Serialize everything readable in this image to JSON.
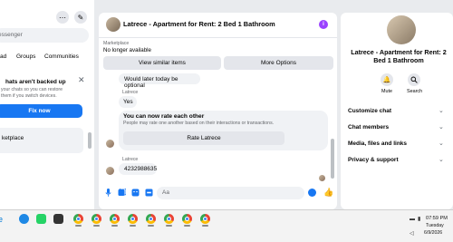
{
  "left_panel": {
    "search_placeholder": "essenger",
    "filters": [
      "ad",
      "Groups",
      "Communities"
    ],
    "backup": {
      "title": "hats aren't backed up",
      "description": "your chats so you can restore them if you switch devices.",
      "button": "Fix now"
    },
    "marketplace_item": "ketplace"
  },
  "chat": {
    "title": "Latrece - Apartment for Rent: 2 Bed 1 Bathroom",
    "info_icon": "i",
    "marketplace_label": "Marketplace",
    "listing_status": "No longer available",
    "view_similar": "View similar items",
    "more_options": "More Options",
    "messages": [
      {
        "text": "Would later today be optional"
      },
      {
        "sender": "Latrece",
        "text": "Yes"
      },
      {
        "sender": "Latrece",
        "text": "4232988635"
      }
    ],
    "rate_card": {
      "title": "You can now rate each other",
      "description": "People may rate one another based on their interactions or transactions.",
      "button": "Rate Latrece"
    },
    "input_placeholder": "Aa",
    "like_icon": "👍"
  },
  "right_panel": {
    "title": "Latrece - Apartment for Rent: 2 Bed 1 Bathroom",
    "actions": [
      {
        "label": "Mute",
        "icon": "bell-icon"
      },
      {
        "label": "Search",
        "icon": "search-icon"
      }
    ],
    "sections": [
      "Customize chat",
      "Chat members",
      "Media, files and links",
      "Privacy & support"
    ]
  },
  "taskbar": {
    "time": "07:59 PM",
    "day": "Tuesday",
    "date": "6/9/2026"
  },
  "colors": {
    "accent": "#1877f2",
    "info_purple": "#9b42ff"
  }
}
